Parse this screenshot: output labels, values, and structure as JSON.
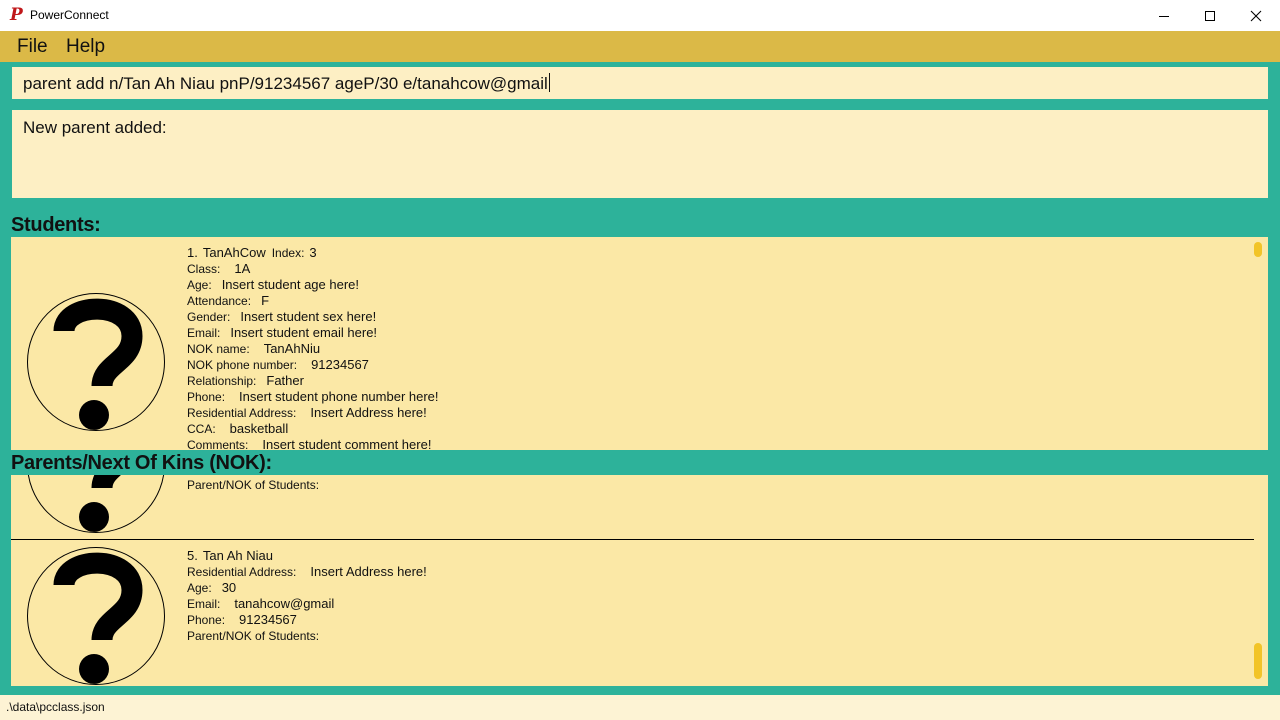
{
  "window": {
    "title": "PowerConnect",
    "logo_letter": "P",
    "minimize_icon": "minimize-icon",
    "maximize_icon": "maximize-icon",
    "close_icon": "close-icon"
  },
  "menu": {
    "file": "File",
    "help": "Help"
  },
  "command": {
    "value": "parent add n/Tan Ah Niau pnP/91234567 ageP/30 e/tanahcow@gmail"
  },
  "result": {
    "text": "New parent added:"
  },
  "students": {
    "title": "Students:",
    "cards": [
      {
        "index_prefix": "1.",
        "name": "TanAhCow",
        "index_label": "Index:",
        "index_value": "3",
        "class_label": "Class:",
        "class_value": "1A",
        "age_label": "Age:",
        "age_value": "Insert student age here!",
        "attendance_label": "Attendance:",
        "attendance_value": "F",
        "gender_label": "Gender:",
        "gender_value": "Insert student sex here!",
        "email_label": "Email:",
        "email_value": "Insert student email here!",
        "nok_name_label": "NOK name:",
        "nok_name_value": "TanAhNiu",
        "nok_phone_label": "NOK phone number:",
        "nok_phone_value": "91234567",
        "relationship_label": "Relationship:",
        "relationship_value": "Father",
        "phone_label": "Phone:",
        "phone_value": "Insert student phone number here!",
        "address_label": "Residential Address:",
        "address_value": "Insert Address here!",
        "cca_label": "CCA:",
        "cca_value": "basketball",
        "comments_label": "Comments:",
        "comments_value": "Insert student comment here!"
      }
    ]
  },
  "parents": {
    "title": "Parents/Next Of Kins (NOK):",
    "partial_card": {
      "students_label": "Parent/NOK of Students:"
    },
    "cards": [
      {
        "index_prefix": "5.",
        "name": "Tan Ah Niau",
        "address_label": "Residential Address:",
        "address_value": "Insert Address here!",
        "age_label": "Age:",
        "age_value": "30",
        "email_label": "Email:",
        "email_value": "tanahcow@gmail",
        "phone_label": "Phone:",
        "phone_value": "91234567",
        "students_label": "Parent/NOK of Students:"
      }
    ]
  },
  "status": {
    "path": ".\\data\\pcclass.json"
  },
  "colors": {
    "background": "#2db29a",
    "menubar": "#dbb947",
    "panel": "#fbe8a6",
    "input": "#fdefc4",
    "scrollbar": "#f2c428"
  }
}
